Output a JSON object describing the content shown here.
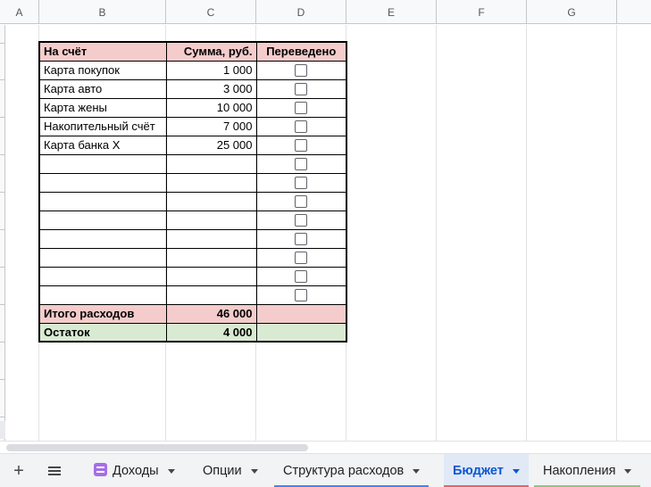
{
  "columns": [
    "A",
    "B",
    "C",
    "D",
    "E",
    "F",
    "G"
  ],
  "table": {
    "header": {
      "account": "На счёт",
      "amount": "Сумма, руб.",
      "transferred": "Переведено"
    },
    "rows": [
      {
        "account": "Карта покупок",
        "amount": "1 000",
        "transferred": false
      },
      {
        "account": "Карта авто",
        "amount": "3 000",
        "transferred": false
      },
      {
        "account": "Карта жены",
        "amount": "10 000",
        "transferred": false
      },
      {
        "account": "Накопительный счёт",
        "amount": "7 000",
        "transferred": false
      },
      {
        "account": "Карта банка Х",
        "amount": "25 000",
        "transferred": false
      },
      {
        "account": "",
        "amount": "",
        "transferred": false
      },
      {
        "account": "",
        "amount": "",
        "transferred": false
      },
      {
        "account": "",
        "amount": "",
        "transferred": false
      },
      {
        "account": "",
        "amount": "",
        "transferred": false
      },
      {
        "account": "",
        "amount": "",
        "transferred": false
      },
      {
        "account": "",
        "amount": "",
        "transferred": false
      },
      {
        "account": "",
        "amount": "",
        "transferred": false
      },
      {
        "account": "",
        "amount": "",
        "transferred": false
      }
    ],
    "total": {
      "label": "Итого расходов",
      "amount": "46 000"
    },
    "remainder": {
      "label": "Остаток",
      "amount": "4 000"
    }
  },
  "tabbar": {
    "add_icon": "plus-icon",
    "all_sheets_icon": "menu-icon",
    "tabs": [
      {
        "label": "Доходы",
        "icon": "sheet-list-icon",
        "active": false,
        "color": ""
      },
      {
        "label": "Опции",
        "active": false,
        "color": ""
      },
      {
        "label": "Структура расходов",
        "active": false,
        "color": "#4285f4"
      },
      {
        "label": "Бюджет",
        "active": true,
        "color": "#e06666"
      },
      {
        "label": "Накопления",
        "active": false,
        "color": "#93c47d"
      }
    ]
  },
  "colors": {
    "header_fill": "#f4cccc",
    "total_fill": "#f4cccc",
    "remainder_fill": "#d9ead3",
    "active_tab_text": "#0b57d0"
  }
}
